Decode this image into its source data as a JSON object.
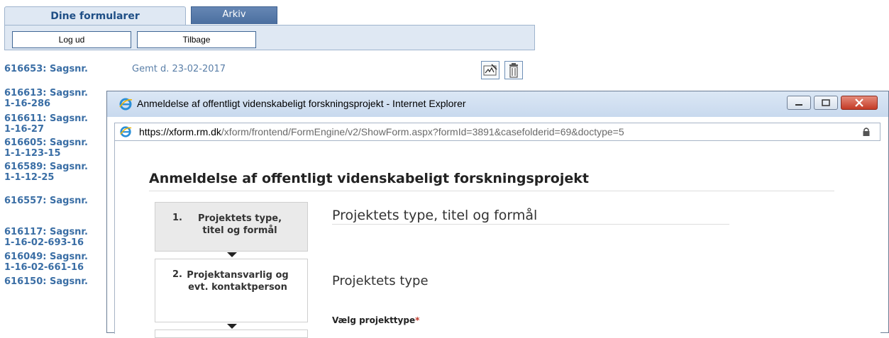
{
  "tabs": {
    "active": "Dine formularer",
    "archive": "Arkiv"
  },
  "buttons": {
    "logout": "Log ud",
    "back": "Tilbage"
  },
  "first_row": {
    "case": "616653: Sagsnr.",
    "saved": "Gemt d. 23-02-2017"
  },
  "cases": [
    {
      "line1": "616613: Sagsnr.",
      "line2": "1-16-286"
    },
    {
      "line1": "616611: Sagsnr.",
      "line2": "1-16-27"
    },
    {
      "line1": "616605: Sagsnr.",
      "line2": "1-1-123-15"
    },
    {
      "line1": "616589: Sagsnr.",
      "line2": "1-1-12-25"
    },
    {
      "line1": "616557: Sagsnr.",
      "line2": ""
    },
    {
      "line1": "616117: Sagsnr.",
      "line2": "1-16-02-693-16"
    },
    {
      "line1": "616049: Sagsnr.",
      "line2": "1-16-02-661-16"
    },
    {
      "line1": "616150: Sagsnr.",
      "line2": ""
    }
  ],
  "window": {
    "title": "Anmeldelse af offentligt videnskabeligt forskningsprojekt - Internet Explorer",
    "url_host": "https://xform.rm.dk",
    "url_path": "/xform/frontend/FormEngine/v2/ShowForm.aspx?formId=3891&casefolderid=69&doctype=5"
  },
  "form": {
    "title": "Anmeldelse af offentligt videnskabeligt forskningsprojekt",
    "steps": [
      {
        "num": "1.",
        "label": "Projektets type, titel og formål"
      },
      {
        "num": "2.",
        "label": "Projektansvarlig og evt. kontaktperson"
      }
    ],
    "section_title": "Projektets type, titel og formål",
    "subsection": "Projektets type",
    "field_label": "Vælg projekttype",
    "required_mark": "*"
  },
  "colors": {
    "link": "#3a6ea5",
    "tab_bg": "#dfe8f3",
    "archive_tab": "#4a6e9f",
    "required": "#c0392b"
  }
}
